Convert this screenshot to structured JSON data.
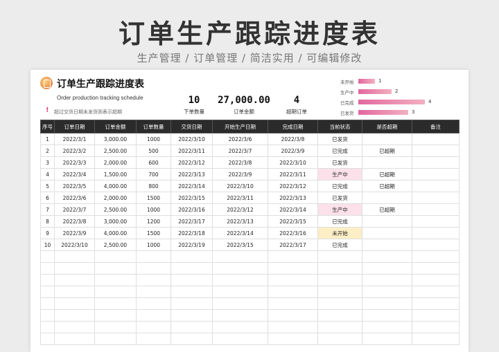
{
  "banner": {
    "title": "订单生产跟踪进度表",
    "subtitle": "生产管理 / 订单管理 / 简洁实用 / 可编辑修改"
  },
  "sheet": {
    "title": "订单生产跟踪进度表",
    "subtitle_en": "Order production tracking schedule",
    "warning_icon": "!",
    "warning_text": "超过交货日期未发货则表示超期"
  },
  "stats": [
    {
      "value": "10",
      "label": "下单数量"
    },
    {
      "value": "27,000.00",
      "label": "订单金额"
    },
    {
      "value": "4",
      "label": "超期订单"
    }
  ],
  "legend": [
    {
      "label": "未开始",
      "value": 1
    },
    {
      "label": "生产中",
      "value": 2
    },
    {
      "label": "已完成",
      "value": 4
    },
    {
      "label": "已发货",
      "value": 3
    }
  ],
  "colors": {
    "header_bg": "#2b2b2b",
    "producing": "#fce1ea",
    "not_started": "#fdeec6",
    "bar_start": "#e2679f",
    "bar_end": "#f3b0bf"
  },
  "table": {
    "headers": [
      "序号",
      "订单日期",
      "订单金额",
      "订单数量",
      "交货日期",
      "开始生产日期",
      "完成日期",
      "当前状态",
      "是否超期",
      "备注"
    ],
    "rows": [
      [
        "1",
        "2022/3/1",
        "3,000.00",
        "1000",
        "2022/3/10",
        "2022/3/6",
        "2022/3/8",
        "已发货",
        "",
        ""
      ],
      [
        "2",
        "2022/3/2",
        "2,500.00",
        "500",
        "2022/3/11",
        "2022/3/7",
        "2022/3/9",
        "已完成",
        "已超期",
        ""
      ],
      [
        "3",
        "2022/3/3",
        "2,000.00",
        "600",
        "2022/3/12",
        "2022/3/8",
        "2022/3/10",
        "已发货",
        "",
        ""
      ],
      [
        "4",
        "2022/3/4",
        "1,500.00",
        "700",
        "2022/3/13",
        "2022/3/9",
        "2022/3/11",
        "生产中",
        "已超期",
        ""
      ],
      [
        "5",
        "2022/3/5",
        "4,000.00",
        "800",
        "2022/3/14",
        "2022/3/10",
        "2022/3/12",
        "已完成",
        "已超期",
        ""
      ],
      [
        "6",
        "2022/3/6",
        "2,000.00",
        "1500",
        "2022/3/15",
        "2022/3/11",
        "2022/3/13",
        "已发货",
        "",
        ""
      ],
      [
        "7",
        "2022/3/7",
        "2,500.00",
        "1000",
        "2022/3/16",
        "2022/3/12",
        "2022/3/14",
        "生产中",
        "已超期",
        ""
      ],
      [
        "8",
        "2022/3/8",
        "3,000.00",
        "1200",
        "2022/3/17",
        "2022/3/13",
        "2022/3/15",
        "已完成",
        "",
        ""
      ],
      [
        "9",
        "2022/3/9",
        "4,000.00",
        "1500",
        "2022/3/18",
        "2022/3/14",
        "2022/3/16",
        "未开始",
        "",
        ""
      ],
      [
        "10",
        "2022/3/10",
        "2,500.00",
        "1000",
        "2022/3/19",
        "2022/3/15",
        "2022/3/17",
        "已完成",
        "",
        ""
      ]
    ]
  }
}
